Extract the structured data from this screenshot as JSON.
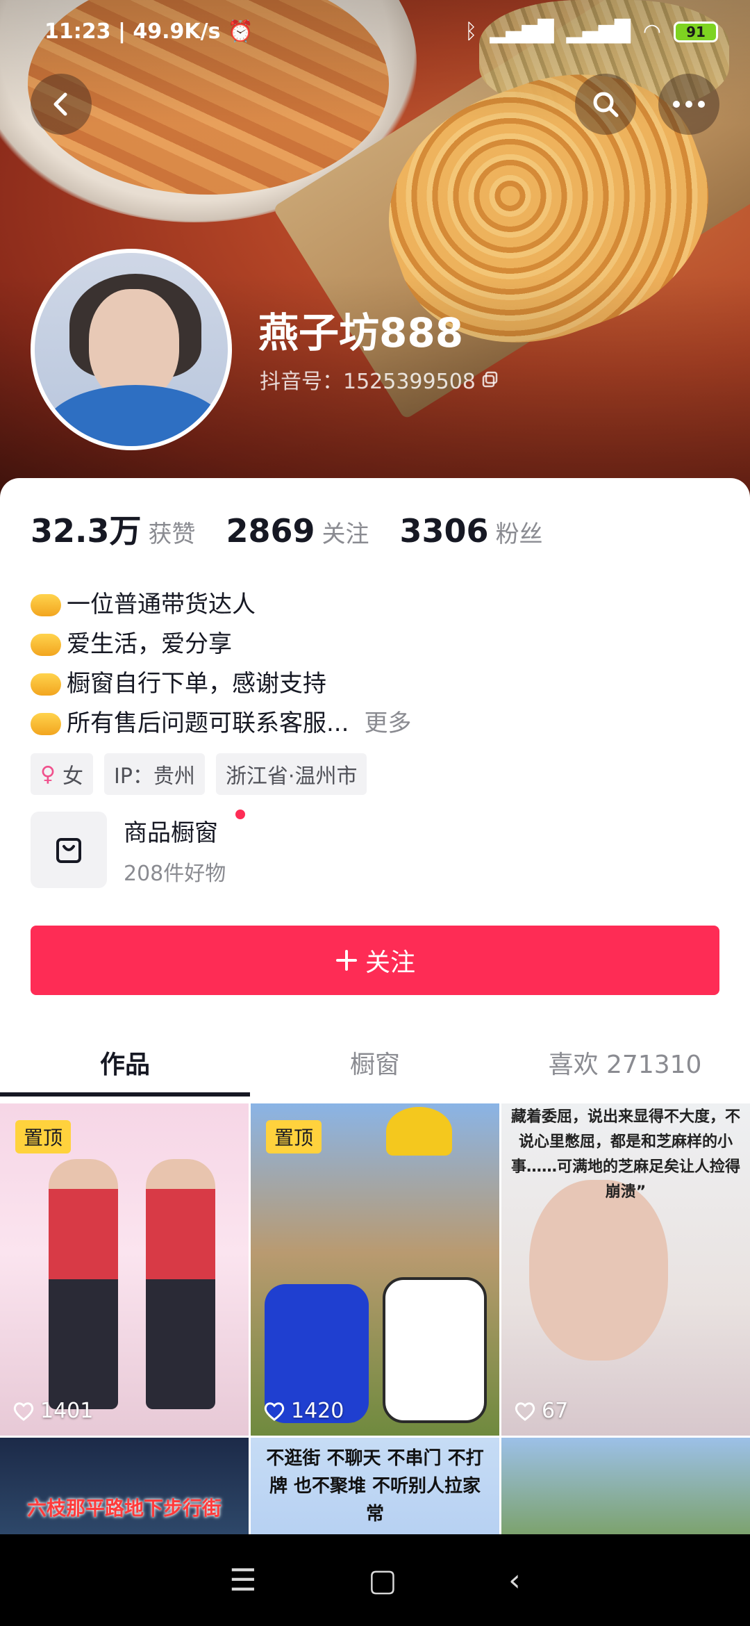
{
  "status_bar": {
    "time": "11:23",
    "net_speed": "49.9K/s",
    "battery": "91"
  },
  "profile": {
    "name": "燕子坊888",
    "douyin_id": "抖音号：1525399508"
  },
  "stats": [
    {
      "value": "32.3万",
      "label": "获赞"
    },
    {
      "value": "2869",
      "label": "关注"
    },
    {
      "value": "3306",
      "label": "粉丝"
    }
  ],
  "bio": {
    "lines": [
      "一位普通带货达人",
      "爱生活，爱分享",
      "橱窗自行下单，感谢支持",
      "所有售后问题可联系客服..."
    ],
    "more": "更多"
  },
  "tags": {
    "gender": "女",
    "ip": "IP：贵州",
    "location": "浙江省·温州市"
  },
  "shop": {
    "title": "商品橱窗",
    "subtitle": "208件好物"
  },
  "follow_button": "关注",
  "tabs": [
    "作品",
    "橱窗",
    "喜欢 271310"
  ],
  "videos": [
    {
      "pinned": "置顶",
      "likes": "1401"
    },
    {
      "pinned": "置顶",
      "likes": "1420"
    },
    {
      "caption": "藏着委屈，说出来显得不大度，不说心里憋屈，都是和芝麻样的小事……可满地的芝麻足矣让人捡得崩溃”",
      "likes": "67"
    },
    {
      "caption": "六枝那平路地下步行街"
    },
    {
      "caption": "不逛街 不聊天 不串门 不打牌 也不聚堆 不听别人拉家常"
    },
    {
      "caption": ""
    }
  ],
  "colors": {
    "accent": "#fe2c55",
    "pin_badge": "#ffd23d"
  }
}
